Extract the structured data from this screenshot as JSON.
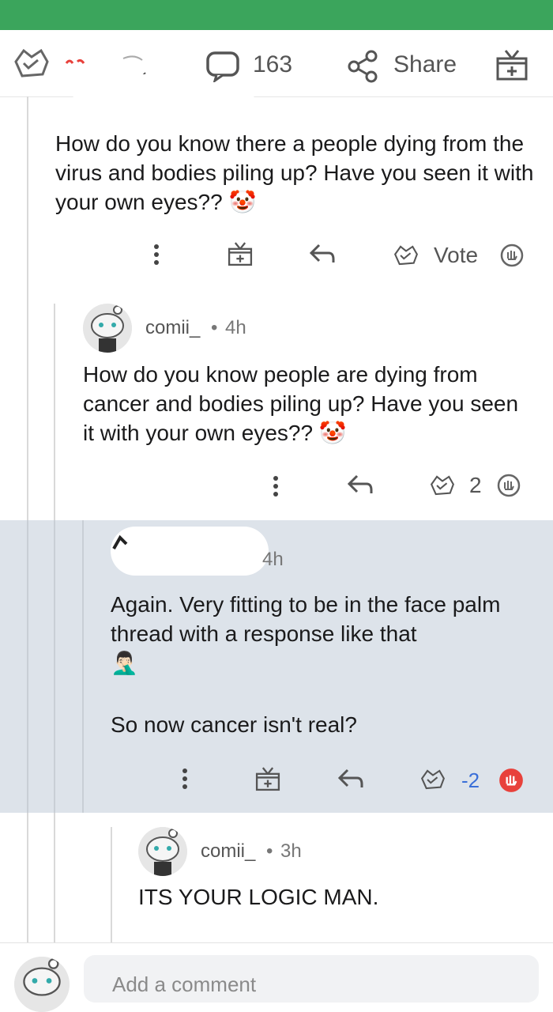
{
  "post_bar": {
    "comment_count": "163",
    "share_label": "Share"
  },
  "comments": [
    {
      "body": "How do you know there a people dying from the virus and bodies piling up? Have you seen it with your own eyes??",
      "emoji": "🤡",
      "vote_label": "Vote"
    },
    {
      "username": "comii_",
      "age": "4h",
      "body": "How do you know people are dying from cancer and bodies piling up? Have you seen it with your own eyes??",
      "emoji": "🤡",
      "score": "2"
    },
    {
      "age": "4h",
      "body_line1": "Again. Very fitting to be in the face palm thread with a response like that",
      "emoji": "🤦🏻‍♂️",
      "body_line2": "So now cancer isn't real?",
      "score": "-2"
    },
    {
      "username": "comii_",
      "age": "3h",
      "body": "ITS YOUR LOGIC MAN."
    }
  ],
  "composer": {
    "placeholder": "Add a comment"
  },
  "colors": {
    "top_bar": "#3ba55c",
    "highlight": "#dde3ea",
    "downvote": "#e8413b",
    "score_blue": "#3a6fd8"
  }
}
